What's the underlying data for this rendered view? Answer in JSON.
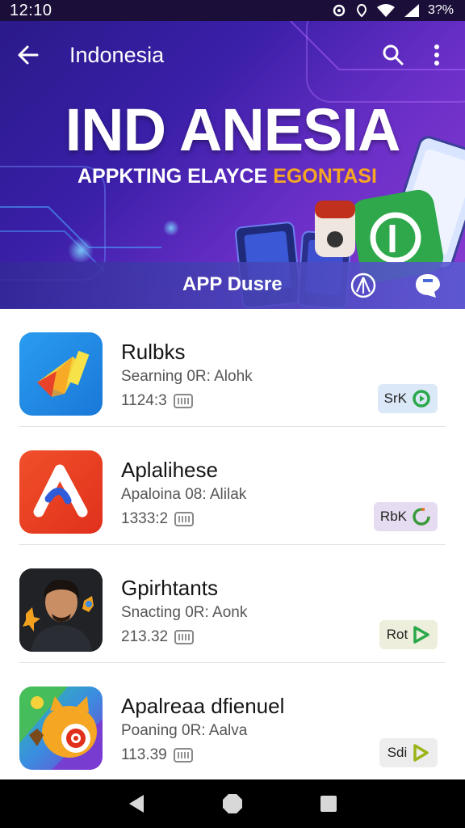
{
  "status_bar": {
    "time": "12:10",
    "battery": "3?%"
  },
  "app_bar": {
    "title": "Indonesia"
  },
  "hero": {
    "title": "IND ANESIA",
    "subtitle_main": "APPKTING ELAYCE ",
    "subtitle_accent": "EGONTASI",
    "strip_label": "APP Dusre"
  },
  "apps": [
    {
      "name": "Rulbks",
      "subtitle": "Searning 0R: Alohk",
      "size": "1124:3",
      "action_label": "SrK",
      "action_color": "#dbe8f7",
      "ring_color": "#2aa84a"
    },
    {
      "name": "Aplalihese",
      "subtitle": "Apaloina 08: Alilak",
      "size": "1333:2",
      "action_label": "RbK",
      "action_color": "#e6dcf2",
      "ring_color": "#3a9a3a"
    },
    {
      "name": "Gpirhtants",
      "subtitle": "Snacting 0R: Aonk",
      "size": "213.32",
      "action_label": "Rot",
      "action_color": "#eeeedc",
      "ring_color": "#2aa84a"
    },
    {
      "name": "Apalreaa dfienuel",
      "subtitle": "Poaning 0R: Aalva",
      "size": "113.39",
      "action_label": "Sdi",
      "action_color": "#ededed",
      "ring_color": "#9ab51a"
    }
  ],
  "colors": {
    "hero_start": "#2a1a8a",
    "hero_end": "#8a3bd0",
    "accent": "#f5a623"
  },
  "icons": [
    "back-arrow-icon",
    "search-icon",
    "more-vert-icon",
    "wifi-icon",
    "signal-icon",
    "home-icon",
    "recents-icon"
  ]
}
